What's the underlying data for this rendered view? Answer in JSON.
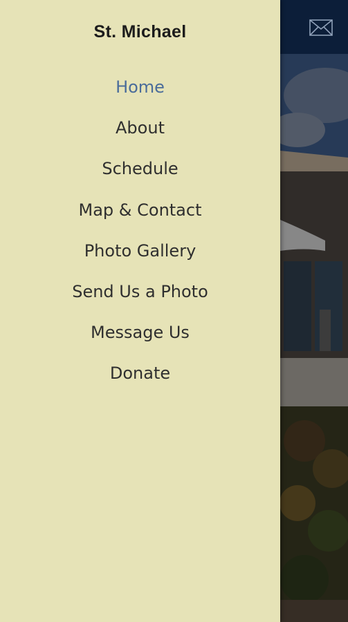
{
  "drawer": {
    "title": "St. Michael",
    "items": [
      {
        "label": "Home",
        "active": true
      },
      {
        "label": "About",
        "active": false
      },
      {
        "label": "Schedule",
        "active": false
      },
      {
        "label": "Map & Contact",
        "active": false
      },
      {
        "label": "Photo Gallery",
        "active": false
      },
      {
        "label": "Send Us a Photo",
        "active": false
      },
      {
        "label": "Message Us",
        "active": false
      },
      {
        "label": "Donate",
        "active": false
      }
    ]
  },
  "topbar": {
    "icon": "mail-icon"
  },
  "colors": {
    "drawer_bg": "#e6e3b7",
    "active_item": "#4a6c9a",
    "item_text": "#2f2f2f",
    "topbar_bg": "#0f2444"
  }
}
